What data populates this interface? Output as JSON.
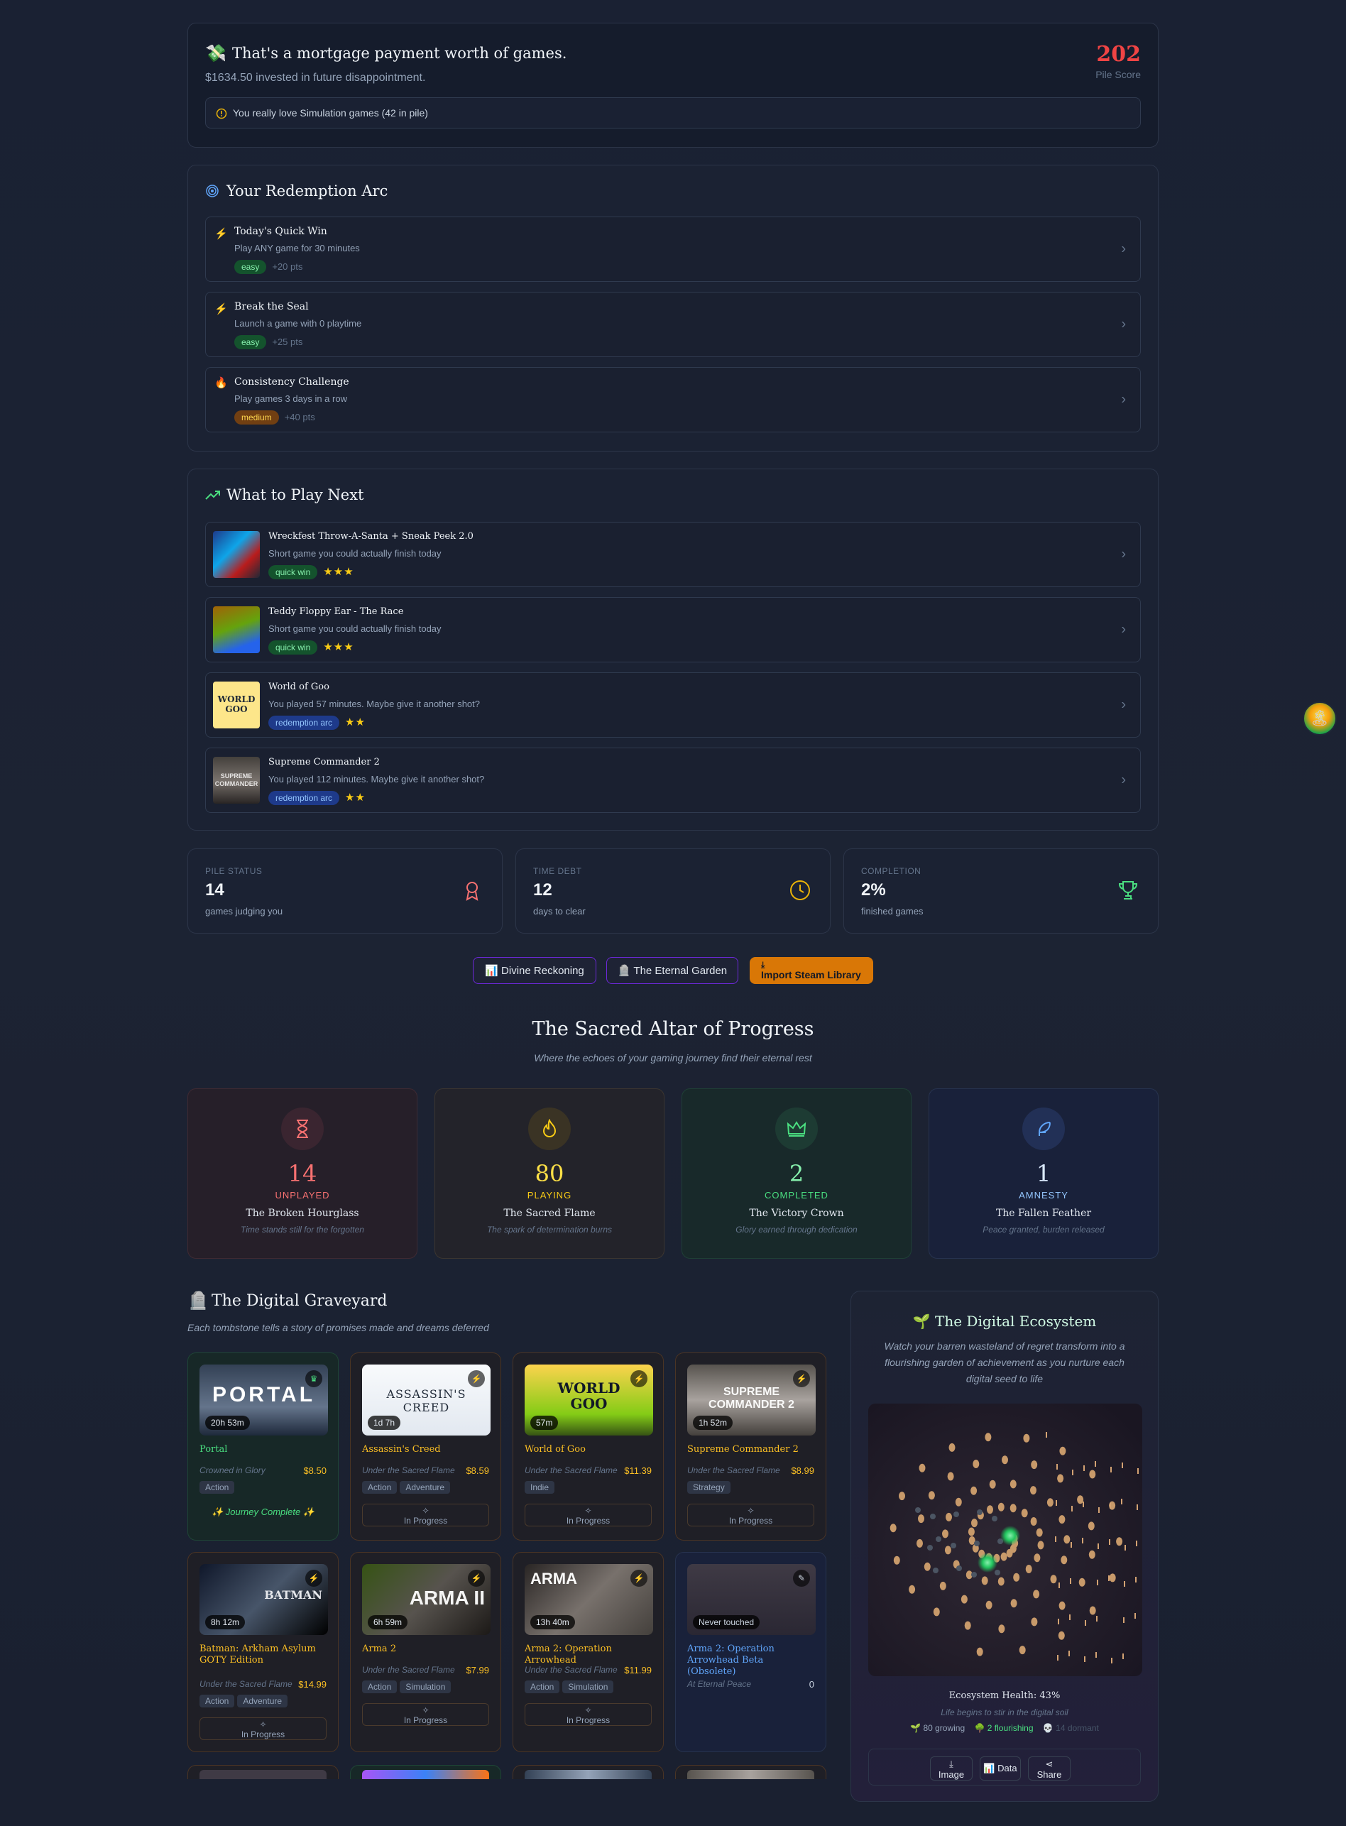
{
  "top": {
    "headline": "That's a mortgage payment worth of games.",
    "subline": "$1634.50 invested in future disappointment.",
    "score": "202",
    "score_label": "Pile Score",
    "alert": "You really love Simulation games (42 in pile)"
  },
  "redemption": {
    "title": "Your Redemption Arc",
    "items": [
      {
        "title": "Today's Quick Win",
        "desc": "Play ANY game for 30 minutes",
        "level": "easy",
        "pts": "+20 pts"
      },
      {
        "title": "Break the Seal",
        "desc": "Launch a game with 0 playtime",
        "level": "easy",
        "pts": "+25 pts"
      },
      {
        "title": "Consistency Challenge",
        "desc": "Play games 3 days in a row",
        "level": "medium",
        "pts": "+40 pts"
      }
    ]
  },
  "next": {
    "title": "What to Play Next",
    "items": [
      {
        "title": "Wreckfest Throw-A-Santa + Sneak Peek 2.0",
        "desc": "Short game you could actually finish today",
        "tag": "quick win",
        "stars": "★★★",
        "thumb_text": ""
      },
      {
        "title": "Teddy Floppy Ear - The Race",
        "desc": "Short game you could actually finish today",
        "tag": "quick win",
        "stars": "★★★",
        "thumb_text": ""
      },
      {
        "title": "World of Goo",
        "desc": "You played 57 minutes. Maybe give it another shot?",
        "tag": "redemption arc",
        "stars": "★★",
        "thumb_text": "WORLD GOO"
      },
      {
        "title": "Supreme Commander 2",
        "desc": "You played 112 minutes. Maybe give it another shot?",
        "tag": "redemption arc",
        "stars": "★★",
        "thumb_text": "SUPREME COMMANDER"
      }
    ]
  },
  "stats": [
    {
      "label": "PILE STATUS",
      "value": "14",
      "sub": "games judging you"
    },
    {
      "label": "TIME DEBT",
      "value": "12",
      "sub": "days to clear"
    },
    {
      "label": "COMPLETION",
      "value": "2%",
      "sub": "finished games"
    }
  ],
  "buttons": {
    "reckoning": "📊 Divine Reckoning",
    "garden": "🪦 The Eternal Garden",
    "import": "Import Steam Library"
  },
  "altar": {
    "title": "The Sacred Altar of Progress",
    "subtitle": "Where the echoes of your gaming journey find their eternal rest",
    "cards": [
      {
        "num": "14",
        "status": "UNPLAYED",
        "name": "The Broken Hourglass",
        "desc": "Time stands still for the forgotten"
      },
      {
        "num": "80",
        "status": "PLAYING",
        "name": "The Sacred Flame",
        "desc": "The spark of determination burns"
      },
      {
        "num": "2",
        "status": "COMPLETED",
        "name": "The Victory Crown",
        "desc": "Glory earned through dedication"
      },
      {
        "num": "1",
        "status": "AMNESTY",
        "name": "The Fallen Feather",
        "desc": "Peace granted, burden released"
      }
    ]
  },
  "graveyard": {
    "title": "The Digital Graveyard",
    "subtitle": "Each tombstone tells a story of promises made and dreams deferred",
    "games": [
      {
        "title": "Portal",
        "time": "20h 53m",
        "status": "Crowned in Glory",
        "price": "$8.50",
        "tags": [
          "Action"
        ],
        "footer": "✨ Journey Complete ✨",
        "img_text": "PORTAL"
      },
      {
        "title": "Assassin's Creed",
        "time": "1d 7h",
        "status": "Under the Sacred Flame",
        "price": "$8.59",
        "tags": [
          "Action",
          "Adventure"
        ],
        "footer": "In Progress",
        "img_text": "ASSASSIN'S CREED"
      },
      {
        "title": "World of Goo",
        "time": "57m",
        "status": "Under the Sacred Flame",
        "price": "$11.39",
        "tags": [
          "Indie"
        ],
        "footer": "In Progress",
        "img_text": "WORLD GOO"
      },
      {
        "title": "Supreme Commander 2",
        "time": "1h 52m",
        "status": "Under the Sacred Flame",
        "price": "$8.99",
        "tags": [
          "Strategy"
        ],
        "footer": "In Progress",
        "img_text": "SUPREME COMMANDER 2"
      },
      {
        "title": "Batman: Arkham Asylum GOTY Edition",
        "time": "8h 12m",
        "status": "Under the Sacred Flame",
        "price": "$14.99",
        "tags": [
          "Action",
          "Adventure"
        ],
        "footer": "In Progress",
        "img_text": "BATMAN"
      },
      {
        "title": "Arma 2",
        "time": "6h 59m",
        "status": "Under the Sacred Flame",
        "price": "$7.99",
        "tags": [
          "Action",
          "Simulation"
        ],
        "footer": "In Progress",
        "img_text": "ARMA II"
      },
      {
        "title": "Arma 2: Operation Arrowhead",
        "time": "13h 40m",
        "status": "Under the Sacred Flame",
        "price": "$11.99",
        "tags": [
          "Action",
          "Simulation"
        ],
        "footer": "In Progress",
        "img_text": "ARMA"
      },
      {
        "title": "Arma 2: Operation Arrowhead Beta (Obsolete)",
        "time": "Never touched",
        "status": "At Eternal Peace",
        "price": "0",
        "tags": [],
        "footer": "",
        "img_text": ""
      }
    ]
  },
  "ecosystem": {
    "title": "The Digital Ecosystem",
    "desc": "Watch your barren wasteland of regret transform into a flourishing garden of achievement as you nurture each digital seed to life",
    "health": "Ecosystem Health: 43%",
    "health_sub": "Life begins to stir in the digital soil",
    "growing": "80 growing",
    "flourishing": "2 flourishing",
    "dormant": "14 dormant",
    "actions": [
      "Image",
      "Data",
      "Share"
    ]
  },
  "colors": {
    "score": "#ef4444",
    "import_btn": "#d97706",
    "unplayed": "#f87171",
    "playing": "#facc15",
    "completed": "#4ade80",
    "amnesty": "#60a5fa"
  }
}
